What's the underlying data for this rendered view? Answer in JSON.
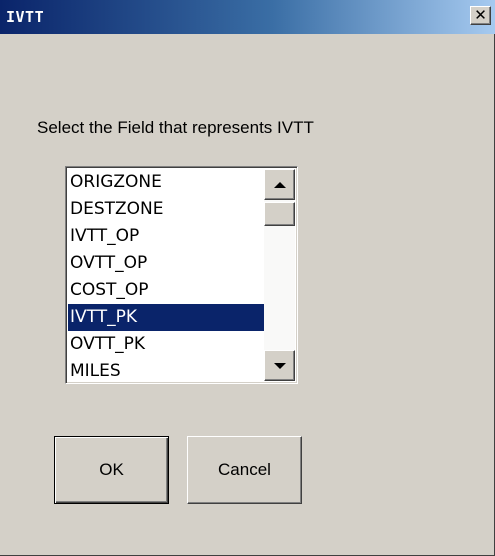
{
  "window": {
    "title": "IVTT",
    "close_glyph": "✕",
    "close_icon": "close-icon"
  },
  "prompt": "Select the Field that represents IVTT",
  "fields": {
    "items": [
      {
        "label": "ORIGZONE",
        "selected": false
      },
      {
        "label": "DESTZONE",
        "selected": false
      },
      {
        "label": "IVTT_OP",
        "selected": false
      },
      {
        "label": "OVTT_OP",
        "selected": false
      },
      {
        "label": "COST_OP",
        "selected": false
      },
      {
        "label": "IVTT_PK",
        "selected": true
      },
      {
        "label": "OVTT_PK",
        "selected": false
      },
      {
        "label": "MILES",
        "selected": false
      }
    ],
    "selected_value": "IVTT_PK"
  },
  "buttons": {
    "ok_label": "OK",
    "cancel_label": "Cancel"
  },
  "colors": {
    "face": "#d4d0c8",
    "title_start": "#0a246a",
    "title_end": "#a6caf0",
    "selection": "#0a246a"
  }
}
